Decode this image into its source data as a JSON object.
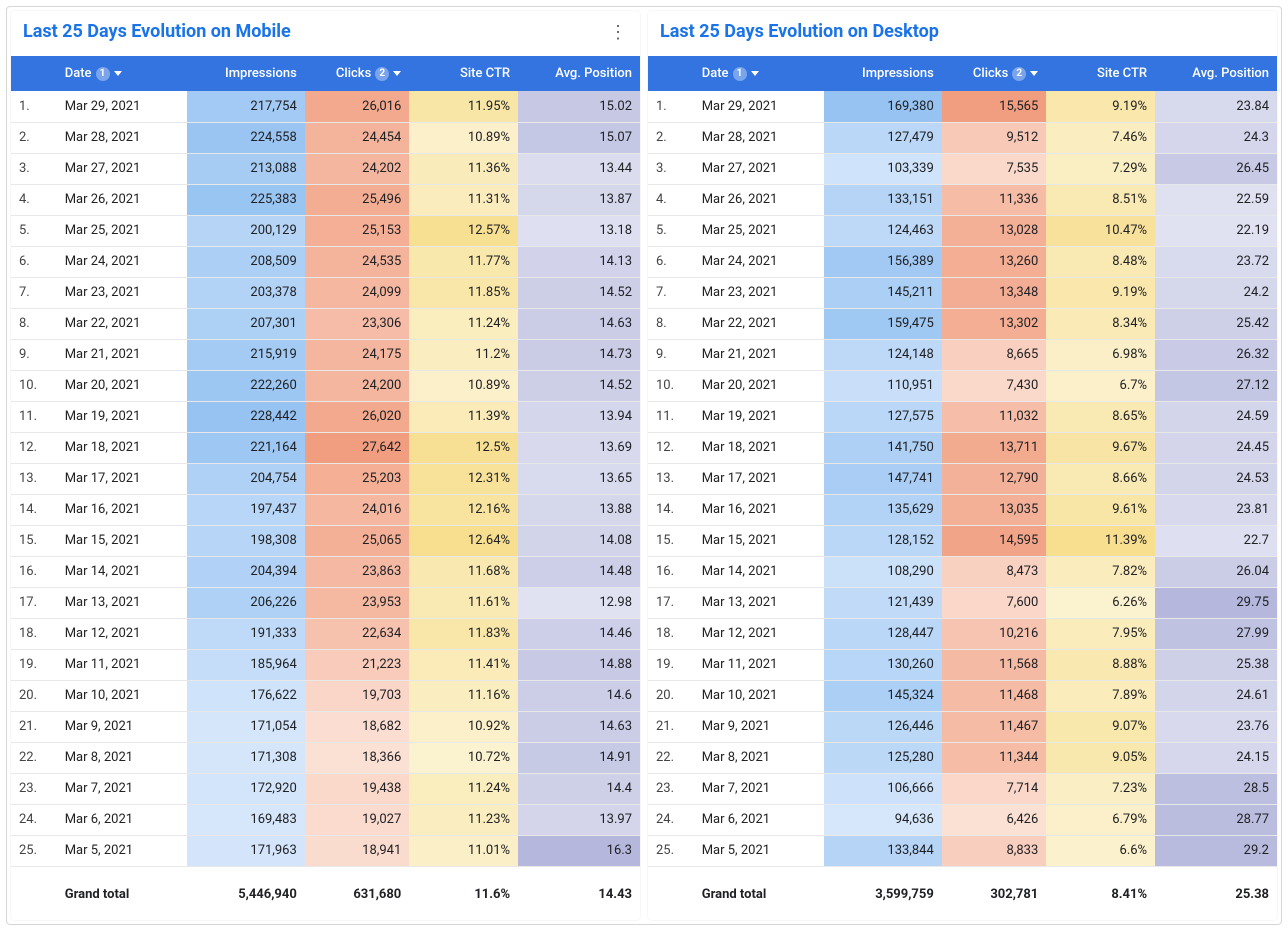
{
  "headers": {
    "date": "Date",
    "impressions": "Impressions",
    "clicks": "Clicks",
    "ctr": "Site CTR",
    "pos": "Avg. Position",
    "info1": "1",
    "info2": "2",
    "grand_total": "Grand total"
  },
  "mobile": {
    "title": "Last 25 Days Evolution on Mobile",
    "rows": [
      {
        "idx": "1.",
        "date": "Mar 29, 2021",
        "impr": "217,754",
        "clicks": "26,016",
        "ctr": "11.95%",
        "pos": "15.02"
      },
      {
        "idx": "2.",
        "date": "Mar 28, 2021",
        "impr": "224,558",
        "clicks": "24,454",
        "ctr": "10.89%",
        "pos": "15.07"
      },
      {
        "idx": "3.",
        "date": "Mar 27, 2021",
        "impr": "213,088",
        "clicks": "24,202",
        "ctr": "11.36%",
        "pos": "13.44"
      },
      {
        "idx": "4.",
        "date": "Mar 26, 2021",
        "impr": "225,383",
        "clicks": "25,496",
        "ctr": "11.31%",
        "pos": "13.87"
      },
      {
        "idx": "5.",
        "date": "Mar 25, 2021",
        "impr": "200,129",
        "clicks": "25,153",
        "ctr": "12.57%",
        "pos": "13.18"
      },
      {
        "idx": "6.",
        "date": "Mar 24, 2021",
        "impr": "208,509",
        "clicks": "24,535",
        "ctr": "11.77%",
        "pos": "14.13"
      },
      {
        "idx": "7.",
        "date": "Mar 23, 2021",
        "impr": "203,378",
        "clicks": "24,099",
        "ctr": "11.85%",
        "pos": "14.52"
      },
      {
        "idx": "8.",
        "date": "Mar 22, 2021",
        "impr": "207,301",
        "clicks": "23,306",
        "ctr": "11.24%",
        "pos": "14.63"
      },
      {
        "idx": "9.",
        "date": "Mar 21, 2021",
        "impr": "215,919",
        "clicks": "24,175",
        "ctr": "11.2%",
        "pos": "14.73"
      },
      {
        "idx": "10.",
        "date": "Mar 20, 2021",
        "impr": "222,260",
        "clicks": "24,200",
        "ctr": "10.89%",
        "pos": "14.52"
      },
      {
        "idx": "11.",
        "date": "Mar 19, 2021",
        "impr": "228,442",
        "clicks": "26,020",
        "ctr": "11.39%",
        "pos": "13.94"
      },
      {
        "idx": "12.",
        "date": "Mar 18, 2021",
        "impr": "221,164",
        "clicks": "27,642",
        "ctr": "12.5%",
        "pos": "13.69"
      },
      {
        "idx": "13.",
        "date": "Mar 17, 2021",
        "impr": "204,754",
        "clicks": "25,203",
        "ctr": "12.31%",
        "pos": "13.65"
      },
      {
        "idx": "14.",
        "date": "Mar 16, 2021",
        "impr": "197,437",
        "clicks": "24,016",
        "ctr": "12.16%",
        "pos": "13.88"
      },
      {
        "idx": "15.",
        "date": "Mar 15, 2021",
        "impr": "198,308",
        "clicks": "25,065",
        "ctr": "12.64%",
        "pos": "14.08"
      },
      {
        "idx": "16.",
        "date": "Mar 14, 2021",
        "impr": "204,394",
        "clicks": "23,863",
        "ctr": "11.68%",
        "pos": "14.48"
      },
      {
        "idx": "17.",
        "date": "Mar 13, 2021",
        "impr": "206,226",
        "clicks": "23,953",
        "ctr": "11.61%",
        "pos": "12.98"
      },
      {
        "idx": "18.",
        "date": "Mar 12, 2021",
        "impr": "191,333",
        "clicks": "22,634",
        "ctr": "11.83%",
        "pos": "14.46"
      },
      {
        "idx": "19.",
        "date": "Mar 11, 2021",
        "impr": "185,964",
        "clicks": "21,223",
        "ctr": "11.41%",
        "pos": "14.88"
      },
      {
        "idx": "20.",
        "date": "Mar 10, 2021",
        "impr": "176,622",
        "clicks": "19,703",
        "ctr": "11.16%",
        "pos": "14.6"
      },
      {
        "idx": "21.",
        "date": "Mar 9, 2021",
        "impr": "171,054",
        "clicks": "18,682",
        "ctr": "10.92%",
        "pos": "14.63"
      },
      {
        "idx": "22.",
        "date": "Mar 8, 2021",
        "impr": "171,308",
        "clicks": "18,366",
        "ctr": "10.72%",
        "pos": "14.91"
      },
      {
        "idx": "23.",
        "date": "Mar 7, 2021",
        "impr": "172,920",
        "clicks": "19,438",
        "ctr": "11.24%",
        "pos": "14.4"
      },
      {
        "idx": "24.",
        "date": "Mar 6, 2021",
        "impr": "169,483",
        "clicks": "19,027",
        "ctr": "11.23%",
        "pos": "13.97"
      },
      {
        "idx": "25.",
        "date": "Mar 5, 2021",
        "impr": "171,963",
        "clicks": "18,941",
        "ctr": "11.01%",
        "pos": "16.3"
      }
    ],
    "totals": {
      "impr": "5,446,940",
      "clicks": "631,680",
      "ctr": "11.6%",
      "pos": "14.43"
    }
  },
  "desktop": {
    "title": "Last 25 Days Evolution on Desktop",
    "rows": [
      {
        "idx": "1.",
        "date": "Mar 29, 2021",
        "impr": "169,380",
        "clicks": "15,565",
        "ctr": "9.19%",
        "pos": "23.84"
      },
      {
        "idx": "2.",
        "date": "Mar 28, 2021",
        "impr": "127,479",
        "clicks": "9,512",
        "ctr": "7.46%",
        "pos": "24.3"
      },
      {
        "idx": "3.",
        "date": "Mar 27, 2021",
        "impr": "103,339",
        "clicks": "7,535",
        "ctr": "7.29%",
        "pos": "26.45"
      },
      {
        "idx": "4.",
        "date": "Mar 26, 2021",
        "impr": "133,151",
        "clicks": "11,336",
        "ctr": "8.51%",
        "pos": "22.59"
      },
      {
        "idx": "5.",
        "date": "Mar 25, 2021",
        "impr": "124,463",
        "clicks": "13,028",
        "ctr": "10.47%",
        "pos": "22.19"
      },
      {
        "idx": "6.",
        "date": "Mar 24, 2021",
        "impr": "156,389",
        "clicks": "13,260",
        "ctr": "8.48%",
        "pos": "23.72"
      },
      {
        "idx": "7.",
        "date": "Mar 23, 2021",
        "impr": "145,211",
        "clicks": "13,348",
        "ctr": "9.19%",
        "pos": "24.2"
      },
      {
        "idx": "8.",
        "date": "Mar 22, 2021",
        "impr": "159,475",
        "clicks": "13,302",
        "ctr": "8.34%",
        "pos": "25.42"
      },
      {
        "idx": "9.",
        "date": "Mar 21, 2021",
        "impr": "124,148",
        "clicks": "8,665",
        "ctr": "6.98%",
        "pos": "26.32"
      },
      {
        "idx": "10.",
        "date": "Mar 20, 2021",
        "impr": "110,951",
        "clicks": "7,430",
        "ctr": "6.7%",
        "pos": "27.12"
      },
      {
        "idx": "11.",
        "date": "Mar 19, 2021",
        "impr": "127,575",
        "clicks": "11,032",
        "ctr": "8.65%",
        "pos": "24.59"
      },
      {
        "idx": "12.",
        "date": "Mar 18, 2021",
        "impr": "141,750",
        "clicks": "13,711",
        "ctr": "9.67%",
        "pos": "24.45"
      },
      {
        "idx": "13.",
        "date": "Mar 17, 2021",
        "impr": "147,741",
        "clicks": "12,790",
        "ctr": "8.66%",
        "pos": "24.53"
      },
      {
        "idx": "14.",
        "date": "Mar 16, 2021",
        "impr": "135,629",
        "clicks": "13,035",
        "ctr": "9.61%",
        "pos": "23.81"
      },
      {
        "idx": "15.",
        "date": "Mar 15, 2021",
        "impr": "128,152",
        "clicks": "14,595",
        "ctr": "11.39%",
        "pos": "22.7"
      },
      {
        "idx": "16.",
        "date": "Mar 14, 2021",
        "impr": "108,290",
        "clicks": "8,473",
        "ctr": "7.82%",
        "pos": "26.04"
      },
      {
        "idx": "17.",
        "date": "Mar 13, 2021",
        "impr": "121,439",
        "clicks": "7,600",
        "ctr": "6.26%",
        "pos": "29.75"
      },
      {
        "idx": "18.",
        "date": "Mar 12, 2021",
        "impr": "128,447",
        "clicks": "10,216",
        "ctr": "7.95%",
        "pos": "27.99"
      },
      {
        "idx": "19.",
        "date": "Mar 11, 2021",
        "impr": "130,260",
        "clicks": "11,568",
        "ctr": "8.88%",
        "pos": "25.38"
      },
      {
        "idx": "20.",
        "date": "Mar 10, 2021",
        "impr": "145,324",
        "clicks": "11,468",
        "ctr": "7.89%",
        "pos": "24.61"
      },
      {
        "idx": "21.",
        "date": "Mar 9, 2021",
        "impr": "126,446",
        "clicks": "11,467",
        "ctr": "9.07%",
        "pos": "23.76"
      },
      {
        "idx": "22.",
        "date": "Mar 8, 2021",
        "impr": "125,280",
        "clicks": "11,344",
        "ctr": "9.05%",
        "pos": "24.15"
      },
      {
        "idx": "23.",
        "date": "Mar 7, 2021",
        "impr": "106,666",
        "clicks": "7,714",
        "ctr": "7.23%",
        "pos": "28.5"
      },
      {
        "idx": "24.",
        "date": "Mar 6, 2021",
        "impr": "94,636",
        "clicks": "6,426",
        "ctr": "6.79%",
        "pos": "28.77"
      },
      {
        "idx": "25.",
        "date": "Mar 5, 2021",
        "impr": "133,844",
        "clicks": "8,833",
        "ctr": "6.6%",
        "pos": "29.2"
      }
    ],
    "totals": {
      "impr": "3,599,759",
      "clicks": "302,781",
      "ctr": "8.41%",
      "pos": "25.38"
    }
  },
  "heat": {
    "impr": {
      "low": "#d7e7fb",
      "high": "#96c3f2"
    },
    "clicks": {
      "low": "#fbe0d4",
      "high": "#f19d7f"
    },
    "ctr": {
      "low": "#fbf2d0",
      "high": "#f7df8f"
    },
    "pos": {
      "low": "#e1e2f1",
      "high": "#b5b8dc"
    }
  }
}
